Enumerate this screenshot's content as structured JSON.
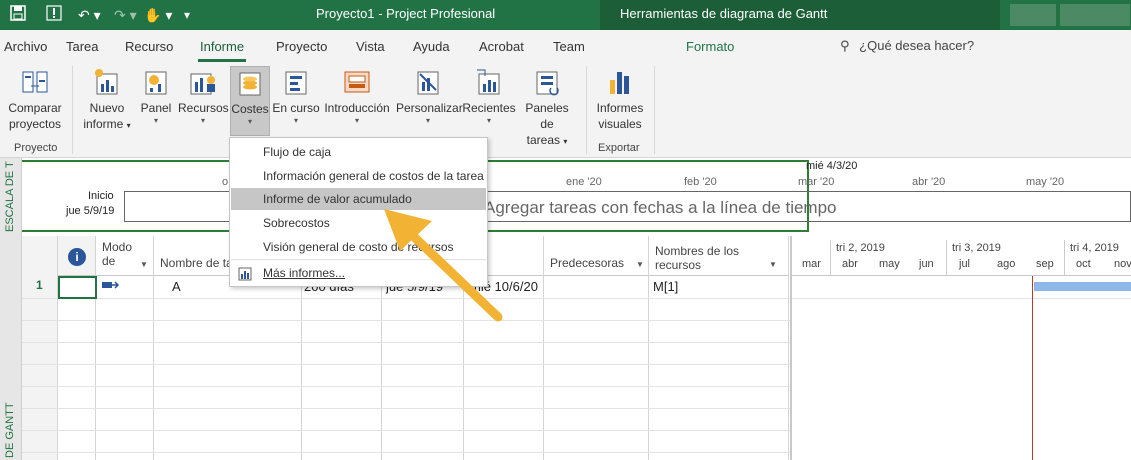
{
  "title_bar": {
    "title": "Proyecto1  -  Project Profesional",
    "contextual_title": "Herramientas de diagrama de Gantt"
  },
  "tabs": [
    "Archivo",
    "Tarea",
    "Recurso",
    "Informe",
    "Proyecto",
    "Vista",
    "Ayuda",
    "Acrobat",
    "Team"
  ],
  "contextual_tab": "Formato",
  "tell_me": "¿Qué desea hacer?",
  "ribbon": {
    "project_group": {
      "button": [
        "Comparar",
        "proyectos"
      ],
      "label": "Proyecto"
    },
    "view_buttons": {
      "nuevo": [
        "Nuevo",
        "informe"
      ],
      "panel": "Panel",
      "recursos": "Recursos",
      "costes": "Costes",
      "encurso": "En curso",
      "intro": "Introducción",
      "personalizar": "Personalizar",
      "recientes": "Recientes",
      "paneles": [
        "Paneles de",
        "tareas"
      ]
    },
    "export_group": {
      "button": [
        "Informes",
        "visuales"
      ],
      "label": "Exportar"
    }
  },
  "costes_menu": {
    "items": [
      "Flujo de caja",
      "Información general de costos de la tarea",
      "Informe de valor acumulado",
      "Sobrecostos",
      "Visión general de costo de recursos"
    ],
    "more": "Más informes..."
  },
  "timeline": {
    "side_label": "ESCALA DE T",
    "start_label": "Inicio",
    "start_date": "jue 5/9/19",
    "today_label": "mié 4/3/20",
    "months": [
      "ene '20",
      "feb '20",
      "mar '20",
      "abr '20",
      "may '20"
    ],
    "placeholder": "Agregar tareas con fechas a la línea de tiempo",
    "first_tick": "o"
  },
  "grid": {
    "side_label": "DE GANTT",
    "headers": {
      "mode": "Modo de",
      "name": "Nombre de ta",
      "pred": "Predecesoras",
      "res": [
        "Nombres de los",
        "recursos"
      ]
    },
    "row": {
      "id": "1",
      "name": "A",
      "duration": "200 días",
      "start": "jue 5/9/19",
      "finish": "mié 10/6/20",
      "resource": "M[1]"
    }
  },
  "gantt_chart": {
    "quarters": [
      "tri 2, 2019",
      "tri 3, 2019",
      "tri 4, 2019"
    ],
    "months": [
      "mar",
      "abr",
      "may",
      "jun",
      "jul",
      "ago",
      "sep",
      "oct",
      "nov"
    ]
  },
  "colors": {
    "brand_green": "#217346",
    "highlight": "#c6c6c6",
    "bar_blue": "#8db8e8",
    "arrow_orange": "#f2b233"
  }
}
